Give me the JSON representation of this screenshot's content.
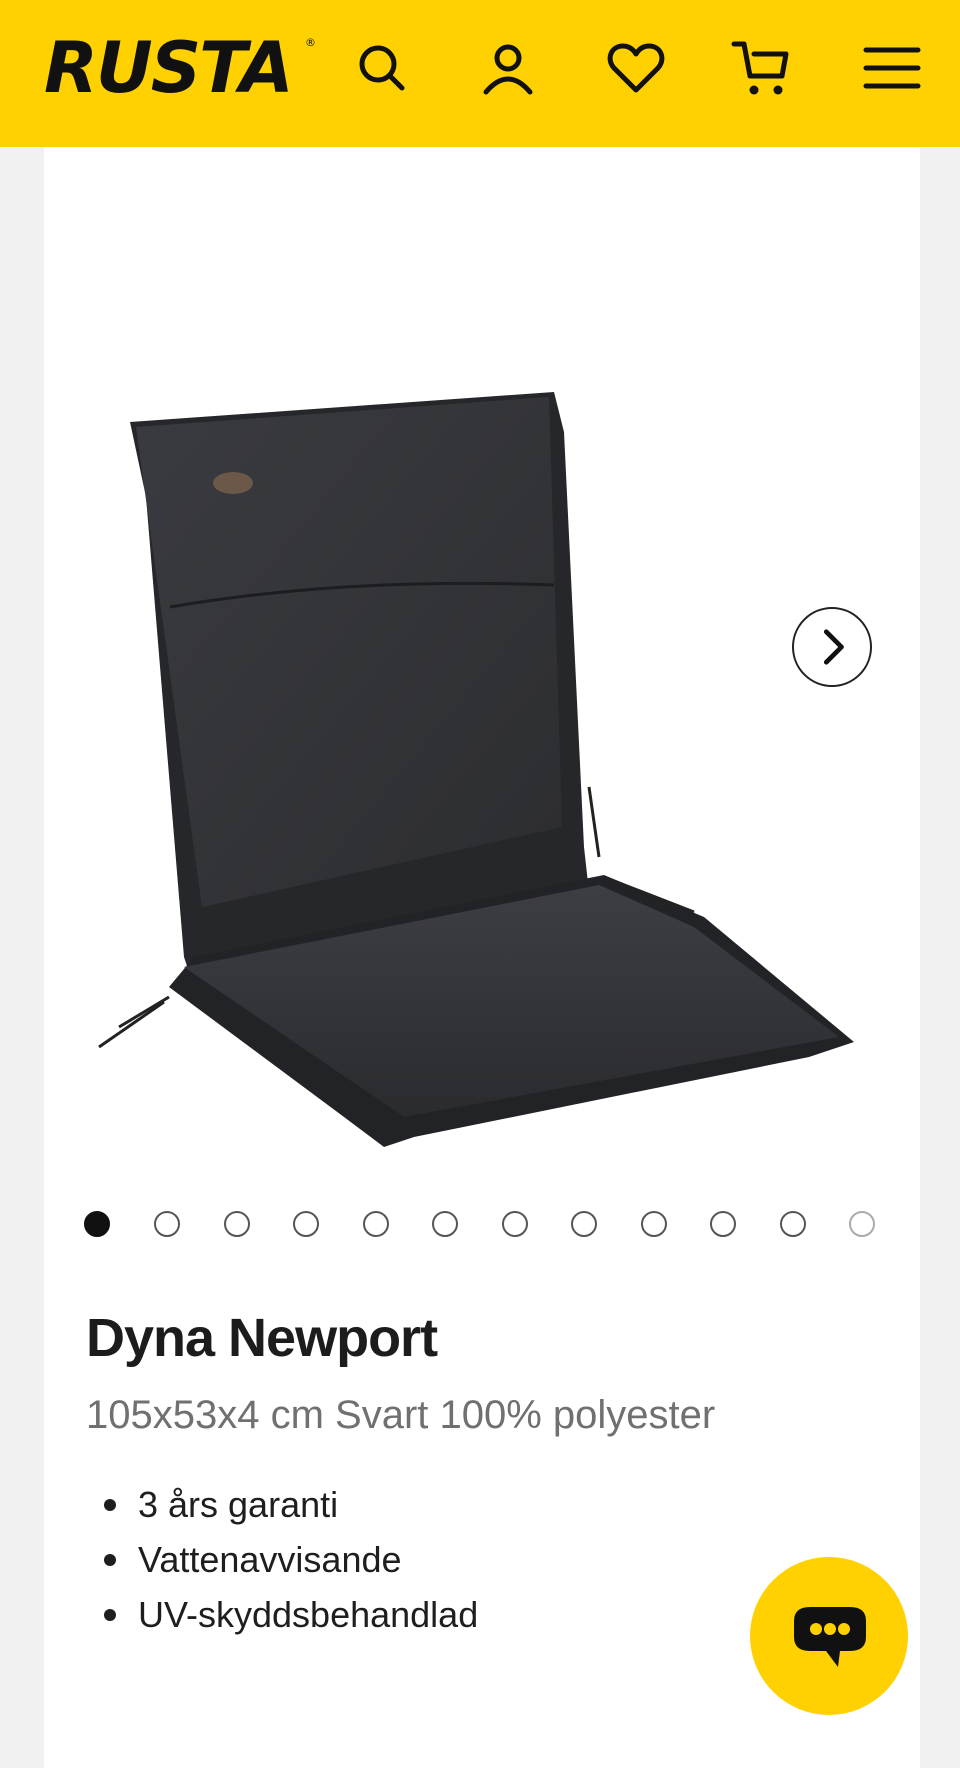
{
  "header": {
    "logo_text": "RUSTA",
    "logo_reg": "®",
    "icons": [
      "search-icon",
      "user-icon",
      "heart-icon",
      "cart-icon",
      "menu-icon"
    ],
    "background": "#ffd100"
  },
  "gallery": {
    "image_alt": "Dyna Newport",
    "slide_count": 12,
    "active_index": 0,
    "next_icon": "chevron-right-icon"
  },
  "product": {
    "title": "Dyna Newport",
    "subtitle": "105x53x4 cm Svart 100% polyester",
    "features": [
      "3 års garanti",
      "Vattenavvisande",
      "UV-skyddsbehandlad"
    ]
  },
  "chat": {
    "icon": "chat-bubble-icon",
    "color": "#ffd100"
  }
}
